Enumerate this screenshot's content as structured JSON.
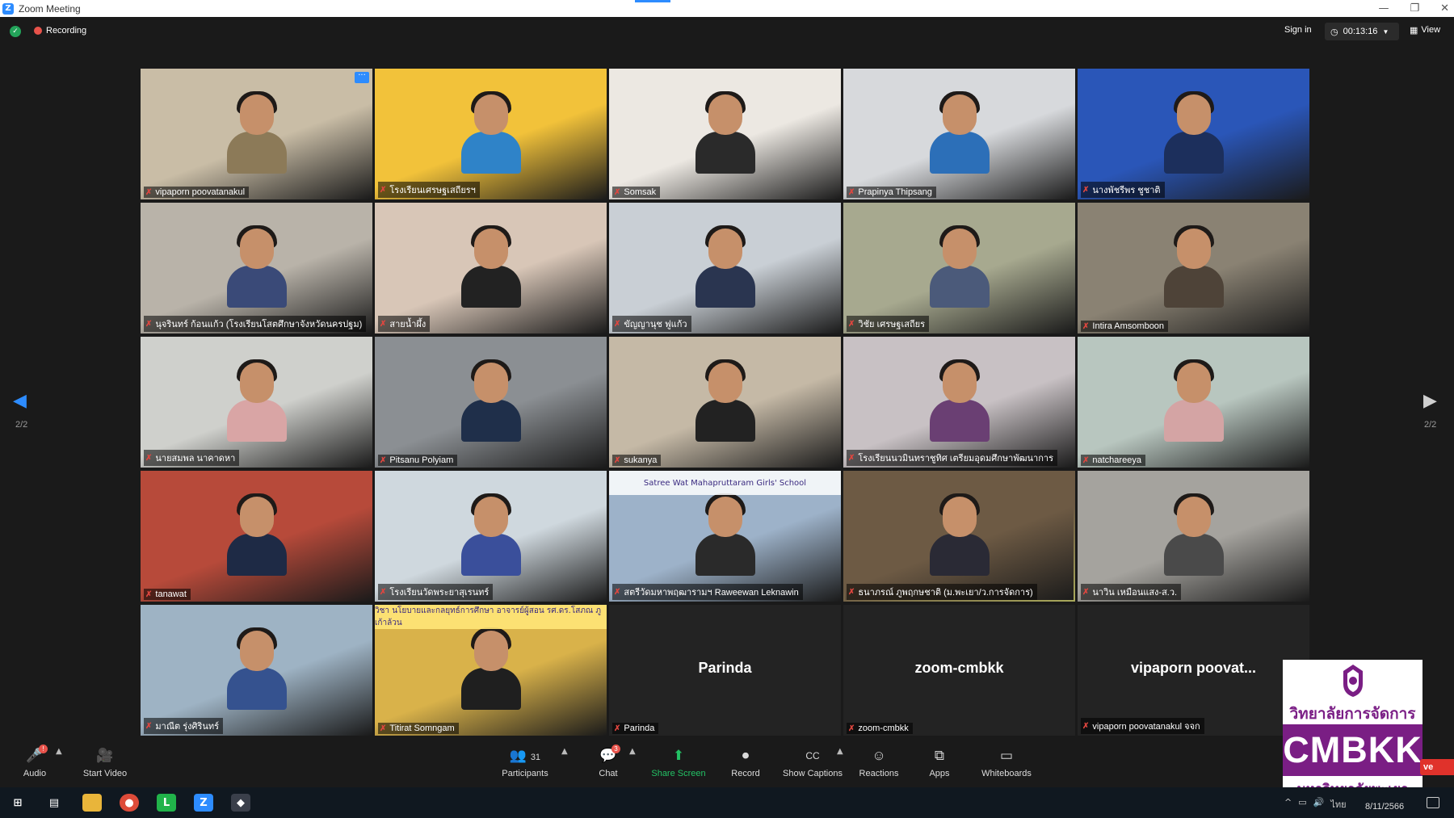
{
  "window": {
    "title": "Zoom Meeting",
    "logo_letter": "Z",
    "controls": [
      "—",
      "❐",
      "✕"
    ]
  },
  "topbar": {
    "recording_label": "Recording",
    "sign_in_label": "Sign in",
    "timer": "00:13:16",
    "view_label": "View"
  },
  "pagination": {
    "left": "2/2",
    "right": "2/2"
  },
  "tiles": [
    {
      "name": "vipaporn poovatanakul",
      "bg": "#c9bda6",
      "shirt": "#8c7a58",
      "more": "···"
    },
    {
      "name": "โรงเรียนเศรษฐเสถียรฯ",
      "bg": "#f2c23a",
      "shirt": "#2f83c8"
    },
    {
      "name": "Somsak",
      "bg": "#ece8e2",
      "shirt": "#2a2a2a"
    },
    {
      "name": "Prapinya Thipsang",
      "bg": "#d7d9dc",
      "shirt": "#2c6fb8"
    },
    {
      "name": "นางพัชรีพร ชูชาติ",
      "bg": "#2a56b8",
      "shirt": "#1c2f5c"
    },
    {
      "name": "นุจรินทร์ ก้อนแก้ว (โรงเรียนโสตศึกษาจังหวัดนครปฐม)",
      "bg": "#b9b3a9",
      "shirt": "#3a4a78"
    },
    {
      "name": "สายน้ำผึ้ง",
      "bg": "#d8c6b7",
      "shirt": "#222222"
    },
    {
      "name": "ขัญญานุช ฟูแก้ว",
      "bg": "#c9cfd5",
      "shirt": "#2a3550"
    },
    {
      "name": "วิชัย เศรษฐเสถียร",
      "bg": "#a7a98f",
      "shirt": "#4b5a7a"
    },
    {
      "name": "Intira Amsomboon",
      "bg": "#8a8273",
      "shirt": "#4e4338"
    },
    {
      "name": "นายสมพล นาคาดหา",
      "bg": "#cfd0cc",
      "shirt": "#d9a5a5"
    },
    {
      "name": "Pitsanu Polyiam",
      "bg": "#8b8f93",
      "shirt": "#1f2f4a"
    },
    {
      "name": "sukanya",
      "bg": "#c5b9a6",
      "shirt": "#222222"
    },
    {
      "name": "โรงเรียนนวมินทราชูทิศ เตรียมอุดมศึกษาพัฒนาการ",
      "bg": "#c8c1c4",
      "shirt": "#6a3f73"
    },
    {
      "name": "natchareeya",
      "bg": "#b8c6bf",
      "shirt": "#d4a4a4"
    },
    {
      "name": "tanawat",
      "bg": "#b74a3a",
      "shirt": "#1e2a45"
    },
    {
      "name": "โรงเรียนวัดพระยาสุเรนทร์",
      "bg": "#cfd8de",
      "shirt": "#3a4f9b"
    },
    {
      "name": "สตรีวัดมหาพฤฒารามฯ Raweewan Leknawin",
      "bg": "#9db2c9",
      "shirt": "#2a2a2a",
      "banner": "Satree Wat Mahapruttaram Girls' School"
    },
    {
      "name": "ธนาภรณ์ ภูพฤกษชาติ (ม.พะเยา/ว.การจัดการ)",
      "bg": "#6d5a44",
      "shirt": "#2a2a35",
      "active": true
    },
    {
      "name": "นาวิน เหมือนแสง-ส.ว.",
      "bg": "#a5a39e",
      "shirt": "#4a4a4a"
    },
    {
      "name": "มาณีต รุ่งศิรินทร์",
      "bg": "#9eb3c4",
      "shirt": "#35528f"
    },
    {
      "name": "Titirat Somngam",
      "bg": "#d9b24a",
      "shirt": "#1f1f1f",
      "banner": "วิชา นโยบายและกลยุทธ์การศึกษา อาจารย์ผู้สอน รศ.ดร.โสภณ ภูเก้าล้วน"
    },
    {
      "name": "Parinda",
      "big": "Parinda"
    },
    {
      "name": "zoom-cmbkk",
      "big": "zoom-cmbkk"
    },
    {
      "name": "vipaporn poovatanakul จจก",
      "big": "vipaporn poovat..."
    }
  ],
  "toolbar": {
    "audio": "Audio",
    "start_video": "Start Video",
    "participants": "Participants",
    "participants_count": "31",
    "chat": "Chat",
    "chat_badge": "3",
    "share": "Share Screen",
    "record": "Record",
    "captions": "Show Captions",
    "reactions": "Reactions",
    "apps": "Apps",
    "whiteboards": "Whiteboards",
    "audio_badge": "!"
  },
  "overlay": {
    "line1": "วิทยาลัยการจัดการ",
    "brand": "CMBKK",
    "line2": "มหาวิทยาลัยพะเยา",
    "live": "ve",
    "colors": {
      "purple": "#7a1e84"
    }
  },
  "taskbar": {
    "date": "8/11/2566"
  }
}
